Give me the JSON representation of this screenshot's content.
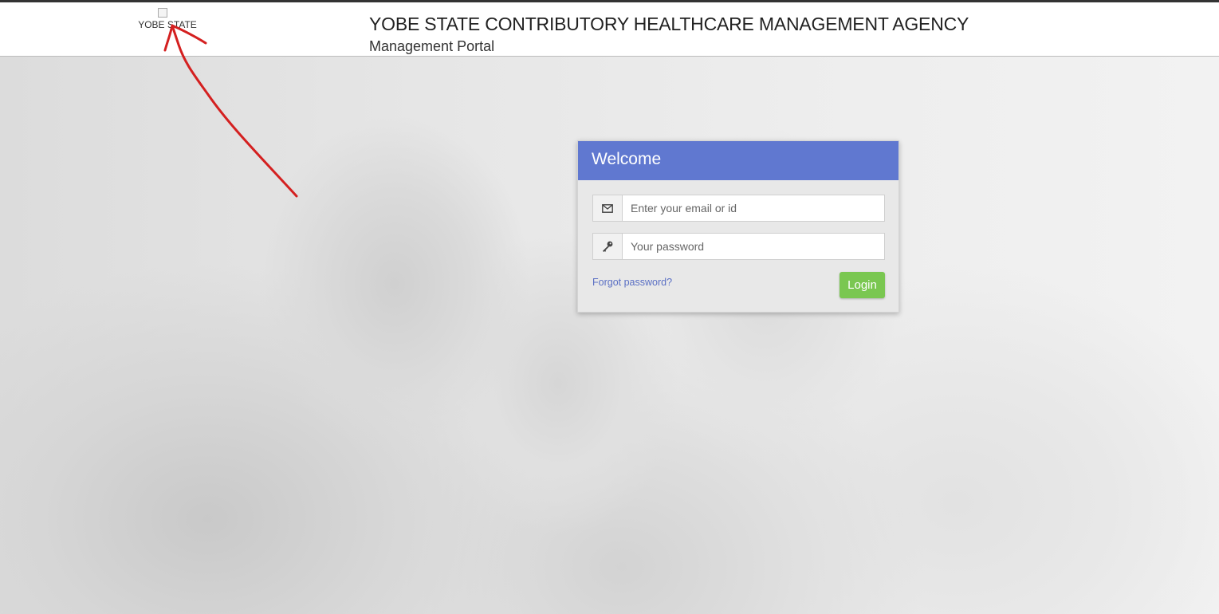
{
  "header": {
    "logo_alt": "YOBE STATE",
    "title": "YOBE STATE CONTRIBUTORY HEALTHCARE MANAGEMENT AGENCY",
    "subtitle": "Management Portal"
  },
  "login": {
    "heading": "Welcome",
    "email_placeholder": "Enter your email or id",
    "email_icon": "envelope-icon",
    "password_placeholder": "Your password",
    "password_icon": "key-icon",
    "forgot_label": "Forgot password?",
    "login_label": "Login"
  },
  "colors": {
    "header_bg": "#ffffff",
    "card_head": "#6078d0",
    "login_button": "#7ac751",
    "link": "#5a6fc4",
    "annotation_arrow": "#d42020"
  }
}
